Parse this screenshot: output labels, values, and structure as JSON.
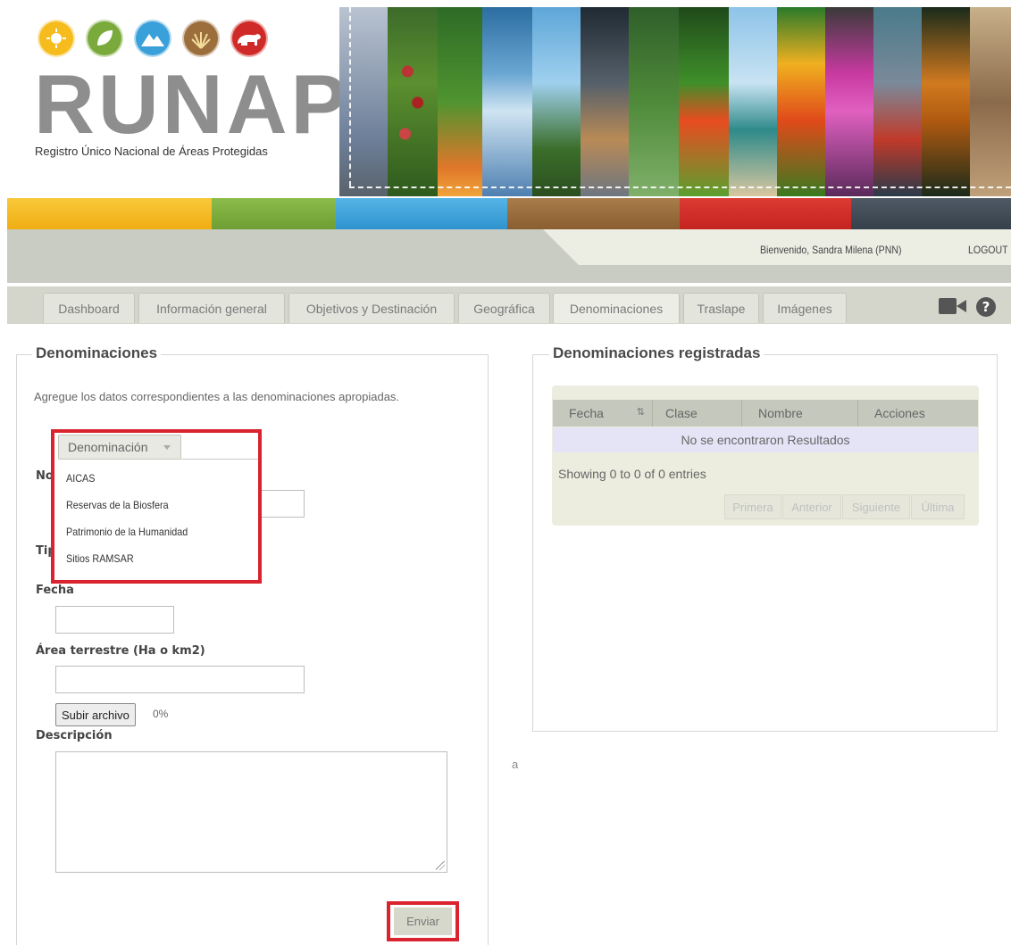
{
  "header": {
    "logo_text": "RUNAP",
    "logo_subtitle": "Registro Único Nacional de Áreas Protegidas",
    "logo_icons": [
      "sun-palm-icon",
      "leaf-icon",
      "mountain-icon",
      "grass-icon",
      "bear-icon"
    ]
  },
  "userbar": {
    "welcome": "Bienvenido, Sandra Milena (PNN)",
    "logout": "LOGOUT"
  },
  "tabs": [
    {
      "label": "Dashboard"
    },
    {
      "label": "Información general"
    },
    {
      "label": "Objetivos y Destinación"
    },
    {
      "label": "Geográfica"
    },
    {
      "label": "Denominaciones"
    },
    {
      "label": "Traslape"
    },
    {
      "label": "Imágenes"
    }
  ],
  "toolbar_icons": [
    "video-camera-icon",
    "help-icon"
  ],
  "form": {
    "legend": "Denominaciones",
    "intro": "Agregue los datos correspondientes a las denominaciones apropiadas.",
    "nombre_label_partial": "No",
    "tipo_label_partial": "Tip",
    "fecha_label": "Fecha",
    "area_label": "Área terrestre (Ha o km2)",
    "upload_button": "Subir archivo",
    "upload_progress": "0%",
    "descripcion_label": "Descripción",
    "submit": "Enviar"
  },
  "dropdown": {
    "selected": "Denominación",
    "options": [
      "AICAS",
      "Reservas de la Biosfera",
      "Patrimonio de la Humanidad",
      "Sitios RAMSAR"
    ]
  },
  "registered": {
    "legend": "Denominaciones registradas",
    "columns": [
      "Fecha",
      "Clase",
      "Nombre",
      "Acciones"
    ],
    "empty_message": "No se encontraron Resultados",
    "info": "Showing 0 to 0 of 0 entries",
    "pager": [
      "Primera",
      "Anterior",
      "Siguiente",
      "Última"
    ]
  },
  "stray_text": "a",
  "colors": {
    "band": [
      "#f6bb1d",
      "#7aaa3b",
      "#3aa0d9",
      "#9b6e3c",
      "#cf2a27",
      "#3f4a55"
    ],
    "highlight": "#d9232e"
  }
}
